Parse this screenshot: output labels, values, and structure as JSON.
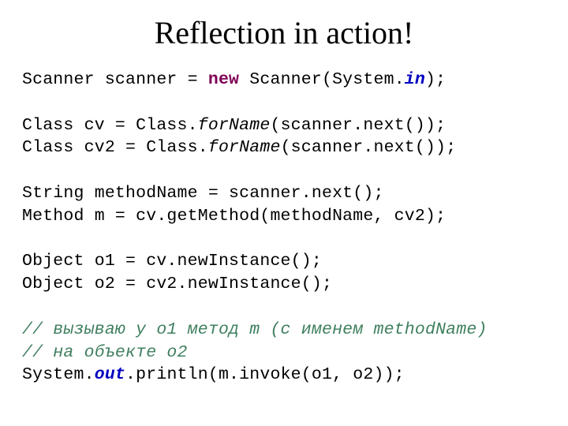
{
  "title": "Reflection in action!",
  "code": {
    "l1a": "Scanner scanner = ",
    "l1b": "new",
    "l1c": " Scanner(System.",
    "l1d": "in",
    "l1e": ");",
    "l2": "",
    "l3a": "Class cv = Class.",
    "l3b": "forName",
    "l3c": "(scanner.next());",
    "l4a": "Class cv2 = Class.",
    "l4b": "forName",
    "l4c": "(scanner.next());",
    "l5": "",
    "l6": "String methodName = scanner.next();",
    "l7": "Method m = cv.getMethod(methodName, cv2);",
    "l8": "",
    "l9": "Object o1 = cv.newInstance();",
    "l10": "Object o2 = cv2.newInstance();",
    "l11": "",
    "l12": "// вызываю у o1 метод m (с именем methodName)",
    "l13": "// на объекте o2",
    "l14a": "System.",
    "l14b": "out",
    "l14c": ".println(m.invoke(o1, o2));"
  }
}
